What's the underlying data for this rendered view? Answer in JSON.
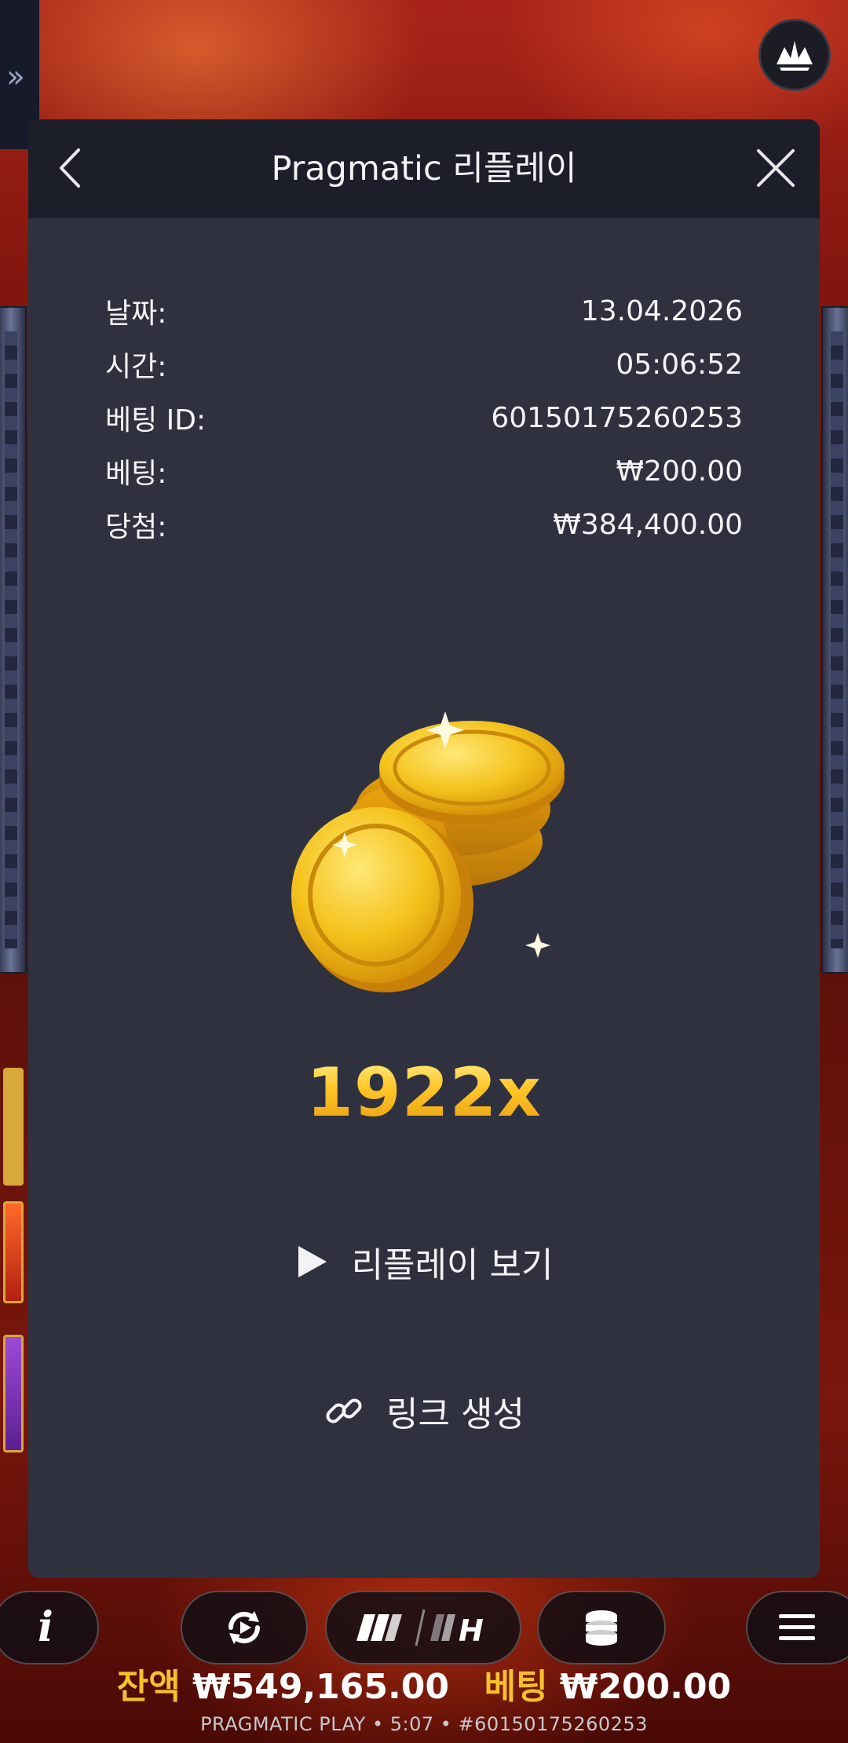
{
  "header": {
    "title": "Pragmatic 리플레이"
  },
  "details": [
    {
      "label": "날짜:",
      "value": "13.04.2026"
    },
    {
      "label": "시간:",
      "value": "05:06:52"
    },
    {
      "label": "베팅 ID:",
      "value": "60150175260253"
    },
    {
      "label": "베팅:",
      "value": "₩200.00"
    },
    {
      "label": "당첨:",
      "value": "₩384,400.00"
    }
  ],
  "win": {
    "multiplier": "1922x",
    "icon": "gold-coins-icon"
  },
  "actions": {
    "replay_label": "리플레이 보기",
    "link_label": "링크 생성"
  },
  "status": {
    "balance_label": "잔액",
    "balance_value": "₩549,165.00",
    "bet_label": "베팅",
    "bet_value": "₩200.00"
  },
  "footer": {
    "text": "PRAGMATIC PLAY • 5:07 • #60150175260253"
  },
  "colors": {
    "modal_bg": "#2f313f",
    "header_bg": "#1c1e2a",
    "accent_gold": "#f6c02e"
  }
}
